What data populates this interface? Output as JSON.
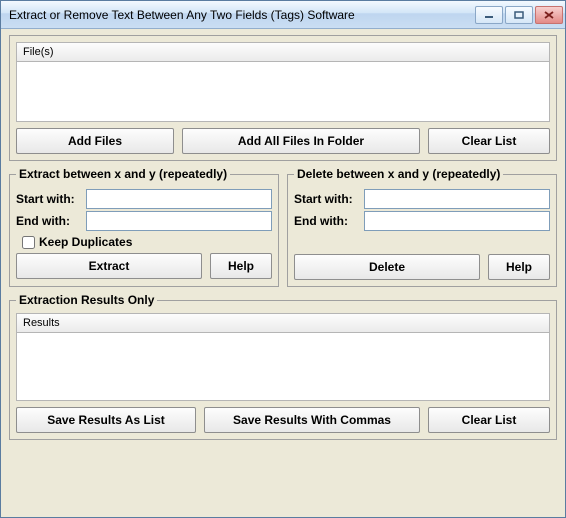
{
  "window": {
    "title": "Extract or Remove Text Between Any Two Fields (Tags) Software"
  },
  "fileSection": {
    "header": "File(s)",
    "addFiles": "Add Files",
    "addFolder": "Add All Files In Folder",
    "clearList": "Clear List"
  },
  "extractGroup": {
    "legend": "Extract between x and y (repeatedly)",
    "startLabel": "Start with:",
    "startValue": "",
    "endLabel": "End with:",
    "endValue": "",
    "keepDup": "Keep Duplicates",
    "keepDupChecked": false,
    "extractBtn": "Extract",
    "helpBtn": "Help"
  },
  "deleteGroup": {
    "legend": "Delete between x and y (repeatedly)",
    "startLabel": "Start with:",
    "startValue": "",
    "endLabel": "End with:",
    "endValue": "",
    "deleteBtn": "Delete",
    "helpBtn": "Help"
  },
  "resultsSection": {
    "legend": "Extraction Results Only",
    "header": "Results",
    "saveList": "Save Results As List",
    "saveCommas": "Save Results With Commas",
    "clearList": "Clear List"
  }
}
